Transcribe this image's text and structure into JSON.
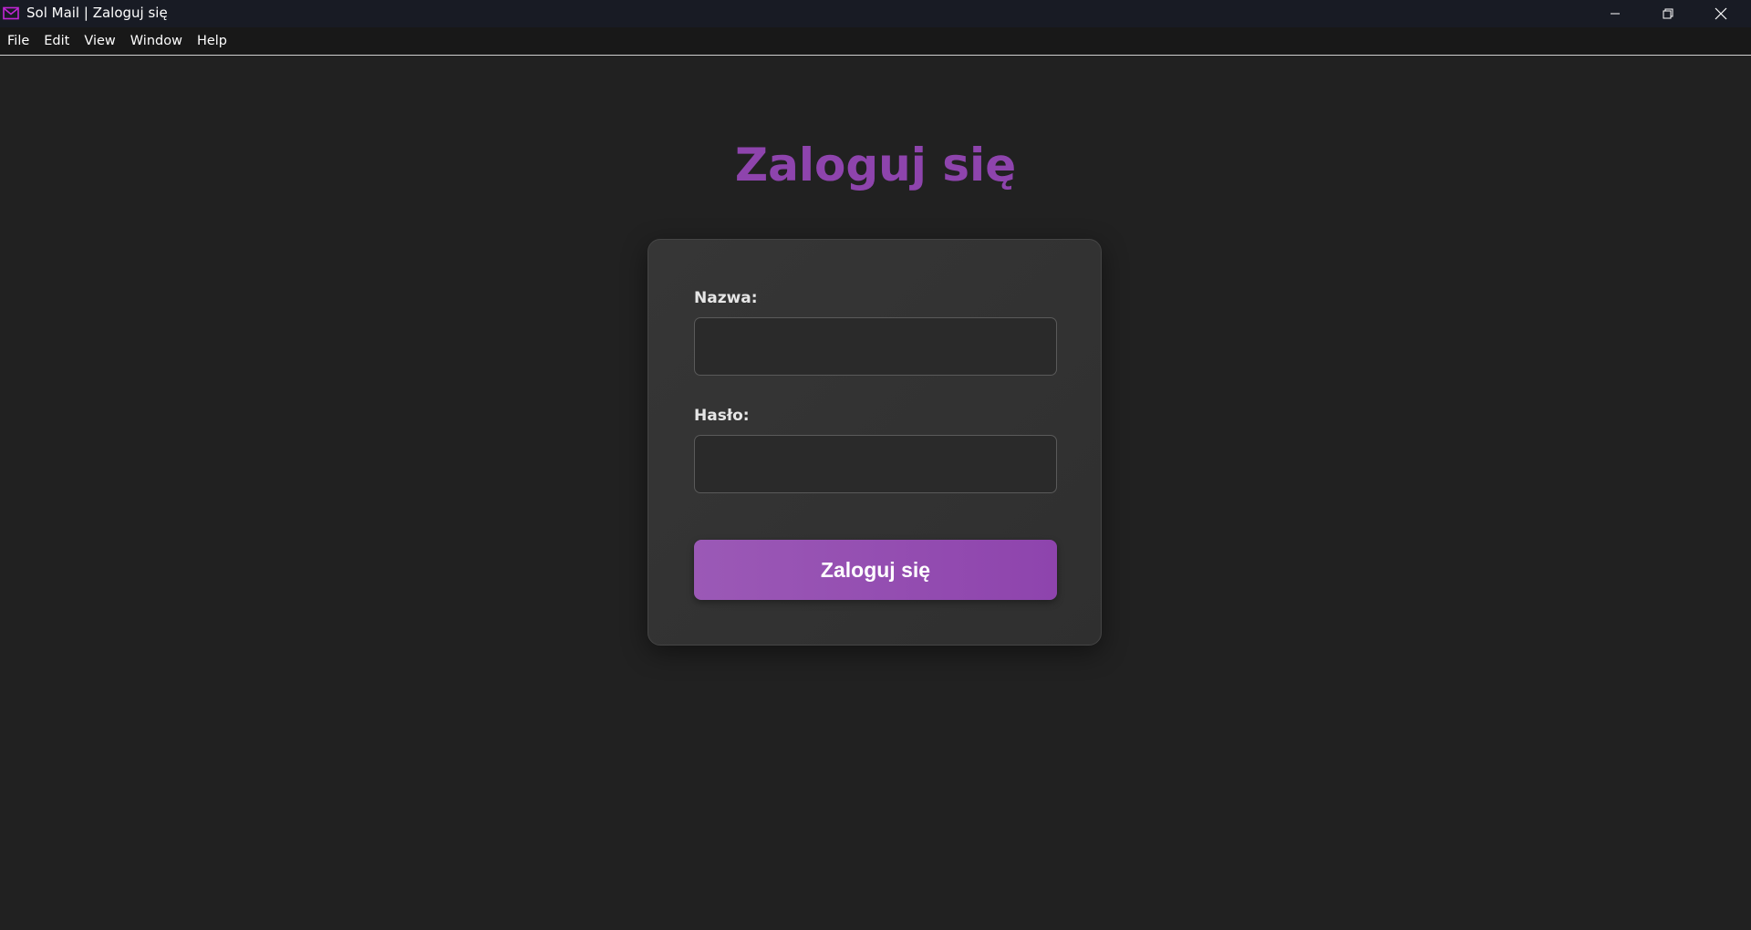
{
  "window": {
    "title": "Sol Mail | Zaloguj się",
    "app_icon": "envelope-icon",
    "controls": [
      "minimize-icon",
      "restore-icon",
      "close-icon"
    ]
  },
  "menu": {
    "items": [
      "File",
      "Edit",
      "View",
      "Window",
      "Help"
    ]
  },
  "login": {
    "heading": "Zaloguj się",
    "username_label": "Nazwa:",
    "username_value": "",
    "password_label": "Hasło:",
    "password_value": "",
    "submit_label": "Zaloguj się"
  },
  "colors": {
    "accent": "#8e44ad",
    "accent_light": "#9b59b6",
    "background": "#212121",
    "card": "#333333"
  }
}
